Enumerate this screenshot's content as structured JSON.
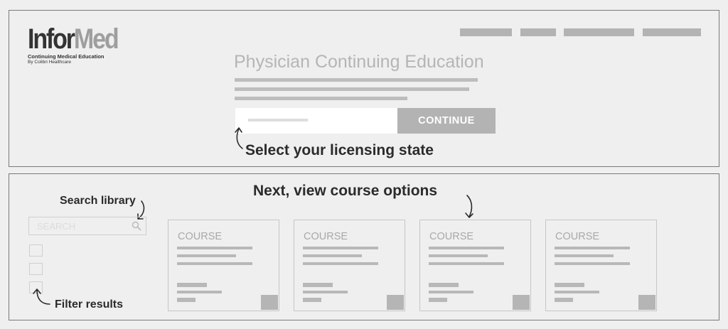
{
  "brand": {
    "logo_part1": "Infor",
    "logo_part2": "Med",
    "tagline": "Continuing Medical Education",
    "byline": "By Colibri Healthcare"
  },
  "hero": {
    "title": "Physician Continuing Education",
    "continue_label": "CONTINUE",
    "state_annotation": "Select your licensing state"
  },
  "library": {
    "annotation": "Next, view course options",
    "search_annotation": "Search library",
    "search_placeholder": "SEARCH",
    "filter_annotation": "Filter results",
    "courses": [
      {
        "label": "COURSE"
      },
      {
        "label": "COURSE"
      },
      {
        "label": "COURSE"
      },
      {
        "label": "COURSE"
      }
    ]
  },
  "icons": {
    "search": "magnifier-icon"
  },
  "colors": {
    "background": "#efefef",
    "frame": "#7a7a7a",
    "placeholder_gray": "#b3b3b3",
    "annotation_text": "#2b2b2b"
  }
}
